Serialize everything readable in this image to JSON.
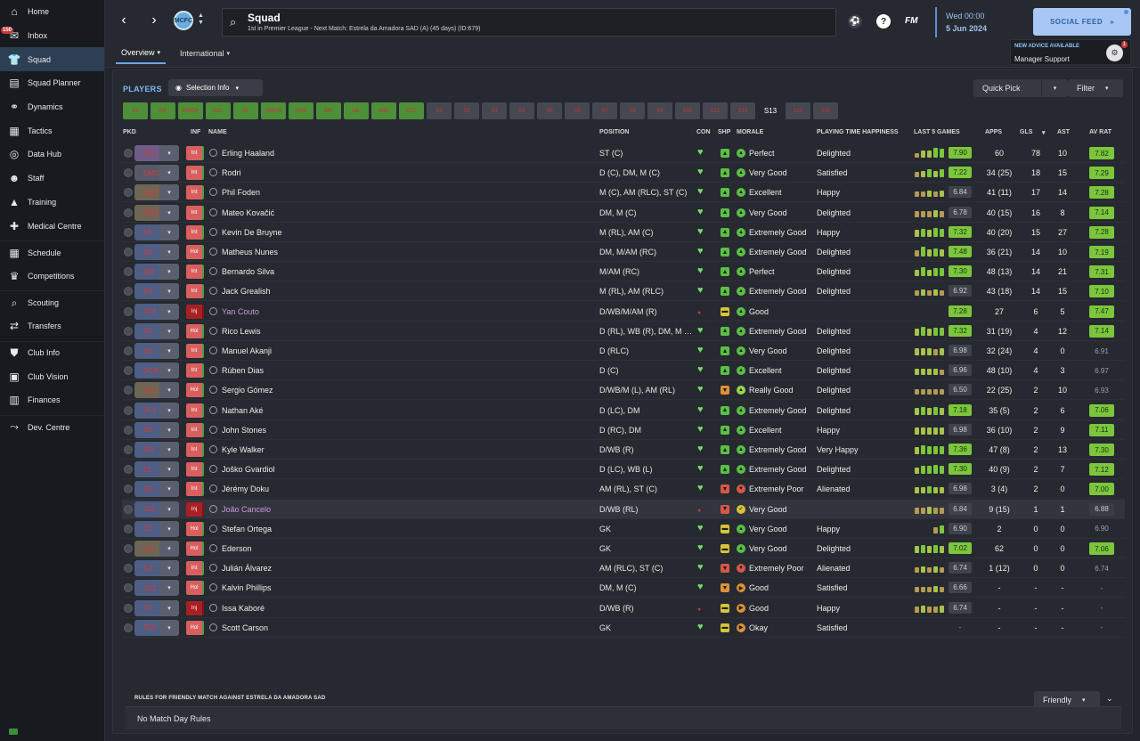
{
  "sidebar": {
    "items": [
      {
        "label": "Home",
        "icon": "home-icon",
        "glyph": "⌂"
      },
      {
        "label": "Inbox",
        "icon": "inbox-icon",
        "glyph": "✉",
        "badge": "150"
      },
      {
        "label": "Squad",
        "icon": "shirt-icon",
        "glyph": "👕",
        "active": true
      },
      {
        "label": "Squad Planner",
        "icon": "clipboard-icon",
        "glyph": "▤"
      },
      {
        "label": "Dynamics",
        "icon": "handshake-icon",
        "glyph": "⚭"
      },
      {
        "label": "Tactics",
        "icon": "tactics-board-icon",
        "glyph": "▦"
      },
      {
        "label": "Data Hub",
        "icon": "data-hub-icon",
        "glyph": "◎"
      },
      {
        "label": "Staff",
        "icon": "staff-icon",
        "glyph": "☻"
      },
      {
        "label": "Training",
        "icon": "training-cone-icon",
        "glyph": "▲"
      },
      {
        "label": "Medical Centre",
        "icon": "medical-kit-icon",
        "glyph": "✚"
      },
      {
        "label": "Schedule",
        "icon": "calendar-icon",
        "glyph": "▦",
        "gap": true
      },
      {
        "label": "Competitions",
        "icon": "trophy-icon",
        "glyph": "♛"
      },
      {
        "label": "Scouting",
        "icon": "magnifier-icon",
        "glyph": "⌕",
        "gap": true
      },
      {
        "label": "Transfers",
        "icon": "transfers-icon",
        "glyph": "⇄"
      },
      {
        "label": "Club Info",
        "icon": "shield-icon",
        "glyph": "⛊",
        "gap": true
      },
      {
        "label": "Club Vision",
        "icon": "briefcase-icon",
        "glyph": "▣"
      },
      {
        "label": "Finances",
        "icon": "finances-icon",
        "glyph": "▥"
      },
      {
        "label": "Dev. Centre",
        "icon": "dev-centre-icon",
        "glyph": "⤳",
        "gap": true
      }
    ]
  },
  "header": {
    "title": "Squad",
    "subtitle": "1st in Premier League - Next Match: Estrela da Amadora SAD (A) (45 days) (ID:679)",
    "fm": "FM",
    "date_day": "Wed 00:00",
    "date_full": "5 Jun 2024",
    "social_feed": "SOCIAL FEED",
    "advice_title": "NEW ADVICE AVAILABLE",
    "advice_sub": "Manager Support",
    "advice_badge": "1",
    "crest": "MCFC"
  },
  "tabs": {
    "overview": "Overview",
    "international": "International"
  },
  "toolbar": {
    "players": "PLAYERS",
    "selection_info": "Selection Info",
    "quick_pick": "Quick Pick",
    "filter": "Filter"
  },
  "chips": [
    {
      "label": "ST",
      "style": "g"
    },
    {
      "label": "GK",
      "style": "g"
    },
    {
      "label": "DMCR",
      "style": "g"
    },
    {
      "label": "DCL",
      "style": "g"
    },
    {
      "label": "DL",
      "style": "g"
    },
    {
      "label": "DMCR",
      "style": "g"
    },
    {
      "label": "AMC",
      "style": "g"
    },
    {
      "label": "MR",
      "style": "g"
    },
    {
      "label": "ML",
      "style": "g"
    },
    {
      "label": "AMC",
      "style": "g"
    },
    {
      "label": "STC",
      "style": "g"
    },
    {
      "label": "S1",
      "style": "d"
    },
    {
      "label": "S2",
      "style": "d"
    },
    {
      "label": "S3",
      "style": "d"
    },
    {
      "label": "S4",
      "style": "d"
    },
    {
      "label": "S5",
      "style": "d"
    },
    {
      "label": "S6",
      "style": "d"
    },
    {
      "label": "S7",
      "style": "d"
    },
    {
      "label": "S8",
      "style": "d"
    },
    {
      "label": "S9",
      "style": "d"
    },
    {
      "label": "S10",
      "style": "d"
    },
    {
      "label": "S11",
      "style": "d"
    },
    {
      "label": "S12",
      "style": "d"
    },
    {
      "label": "S13",
      "style": "b"
    },
    {
      "label": "S14",
      "style": "d"
    },
    {
      "label": "S15",
      "style": "d"
    }
  ],
  "columns": {
    "pkd": "PKD",
    "inf": "INF",
    "name": "NAME",
    "position": "POSITION",
    "con": "CON",
    "shp": "SHP",
    "morale": "MORALE",
    "pth": "PLAYING TIME HAPPINESS",
    "last5": "LAST 5 GAMES",
    "apps": "APPS",
    "gls": "GLS",
    "ast": "AST",
    "avrat": "AV RAT"
  },
  "players": [
    {
      "pkd": "STC",
      "tag": "p",
      "inf": "Int",
      "name": "Erling Haaland",
      "position": "ST (C)",
      "con": "g",
      "shp": "g",
      "mor": "g",
      "morale": "Perfect",
      "pth": "Delighted",
      "last5": [
        0.5,
        0.7,
        0.7,
        1,
        0.9
      ],
      "l5": "7.90",
      "l5c": "gr",
      "apps": "60",
      "gls": "78",
      "ast": "10",
      "avrat": "7.82",
      "avc": "gr"
    },
    {
      "pkd": "DMCL",
      "tag": "s",
      "inf": "Int",
      "name": "Rodri",
      "position": "D (C), DM, M (C)",
      "con": "g",
      "shp": "g",
      "mor": "g",
      "morale": "Very Good",
      "pth": "Satisfied",
      "last5": [
        0.6,
        0.7,
        0.8,
        0.7,
        0.8
      ],
      "l5": "7.22",
      "l5c": "gr",
      "apps": "34 (25)",
      "gls": "18",
      "ast": "15",
      "avrat": "7.29",
      "avc": "gr"
    },
    {
      "pkd": "AMC",
      "tag": "o",
      "inf": "Int",
      "name": "Phil Foden",
      "position": "M (C), AM (RLC), ST (C)",
      "con": "g",
      "shp": "g",
      "mor": "g",
      "morale": "Excellent",
      "pth": "Happy",
      "last5": [
        0.6,
        0.6,
        0.7,
        0.6,
        0.7
      ],
      "l5": "6.84",
      "l5c": "gy",
      "apps": "41 (11)",
      "gls": "17",
      "ast": "14",
      "avrat": "7.28",
      "avc": "gr"
    },
    {
      "pkd": "DMCR",
      "tag": "o",
      "inf": "Int",
      "name": "Mateo Kovačić",
      "position": "DM, M (C)",
      "con": "g",
      "shp": "g",
      "mor": "g",
      "morale": "Very Good",
      "pth": "Delighted",
      "last5": [
        0.6,
        0.6,
        0.6,
        0.7,
        0.6
      ],
      "l5": "6.78",
      "l5c": "gy",
      "apps": "40 (15)",
      "gls": "16",
      "ast": "8",
      "avrat": "7.14",
      "avc": "gr"
    },
    {
      "pkd": "ML",
      "tag": "",
      "inf": "Int",
      "name": "Kevin De Bruyne",
      "position": "M (RL), AM (C)",
      "con": "g",
      "shp": "g",
      "mor": "g",
      "morale": "Extremely Good",
      "pth": "Happy",
      "last5": [
        0.7,
        0.8,
        0.7,
        0.9,
        0.8
      ],
      "l5": "7.32",
      "l5c": "gr",
      "apps": "40 (20)",
      "gls": "15",
      "ast": "27",
      "avrat": "7.28",
      "avc": "gr"
    },
    {
      "pkd": "S6",
      "tag": "",
      "inf": "Hol",
      "name": "Matheus Nunes",
      "position": "DM, M/AM (RC)",
      "con": "g",
      "shp": "g",
      "mor": "g",
      "morale": "Extremely Good",
      "pth": "Delighted",
      "last5": [
        0.6,
        1,
        0.7,
        0.8,
        0.7
      ],
      "l5": "7.48",
      "l5c": "gr",
      "apps": "36 (21)",
      "gls": "14",
      "ast": "10",
      "avrat": "7.19",
      "avc": "gr"
    },
    {
      "pkd": "MR",
      "tag": "",
      "inf": "Int",
      "name": "Bernardo Silva",
      "position": "M/AM (RC)",
      "con": "g",
      "shp": "g",
      "mor": "g",
      "morale": "Perfect",
      "pth": "Delighted",
      "last5": [
        0.7,
        0.9,
        0.7,
        0.8,
        0.8
      ],
      "l5": "7.30",
      "l5c": "gr",
      "apps": "48 (13)",
      "gls": "14",
      "ast": "21",
      "avrat": "7.31",
      "avc": "gr"
    },
    {
      "pkd": "S3",
      "tag": "",
      "inf": "Int",
      "name": "Jack Grealish",
      "position": "M (RL), AM (RLC)",
      "con": "g",
      "shp": "g",
      "mor": "g",
      "morale": "Extremely Good",
      "pth": "Delighted",
      "last5": [
        0.6,
        0.7,
        0.6,
        0.7,
        0.6
      ],
      "l5": "6.92",
      "l5c": "gy",
      "apps": "43 (18)",
      "gls": "14",
      "ast": "15",
      "avrat": "7.10",
      "avc": "gr"
    },
    {
      "pkd": "S14",
      "tag": "",
      "inf": "Inj",
      "name": "Yan Couto",
      "position": "D/WB/M/AM (R)",
      "con": "r",
      "shp": "y",
      "mor": "g",
      "morale": "Good",
      "pth": "",
      "last5": [],
      "l5": "7.28",
      "l5c": "gr",
      "apps": "27",
      "gls": "6",
      "ast": "5",
      "avrat": "7.47",
      "avc": "gr"
    },
    {
      "pkd": "S2",
      "tag": "",
      "inf": "Hol",
      "name": "Rico Lewis",
      "position": "D (RL), WB (R), DM, M (C)",
      "con": "g",
      "shp": "g",
      "mor": "g",
      "morale": "Extremely Good",
      "pth": "Delighted",
      "last5": [
        0.7,
        0.9,
        0.7,
        0.8,
        0.8
      ],
      "l5": "7.32",
      "l5c": "gr",
      "apps": "31 (19)",
      "gls": "4",
      "ast": "12",
      "avrat": "7.14",
      "avc": "gr"
    },
    {
      "pkd": "S8",
      "tag": "",
      "inf": "Int",
      "name": "Manuel Akanji",
      "position": "D (RLC)",
      "con": "g",
      "shp": "g",
      "mor": "g",
      "morale": "Very Good",
      "pth": "Delighted",
      "last5": [
        0.7,
        0.7,
        0.7,
        0.6,
        0.7
      ],
      "l5": "6.98",
      "l5c": "gy",
      "apps": "32 (24)",
      "gls": "4",
      "ast": "0",
      "avrat": "6.91",
      "avc": "no"
    },
    {
      "pkd": "DCR",
      "tag": "",
      "inf": "Int",
      "name": "Rúben Dias",
      "position": "D (C)",
      "con": "g",
      "shp": "g",
      "mor": "g",
      "morale": "Excellent",
      "pth": "Delighted",
      "last5": [
        0.7,
        0.7,
        0.7,
        0.7,
        0.6
      ],
      "l5": "6.96",
      "l5c": "gy",
      "apps": "48 (10)",
      "gls": "4",
      "ast": "3",
      "avrat": "6.97",
      "avc": "no"
    },
    {
      "pkd": "S15",
      "tag": "o",
      "inf": "Hol",
      "name": "Sergio Gómez",
      "position": "D/WB/M (L), AM (RL)",
      "con": "g",
      "shp": "o",
      "mor": "g2",
      "morale": "Really Good",
      "pth": "Delighted",
      "last5": [
        0.6,
        0.6,
        0.6,
        0.6,
        0.6
      ],
      "l5": "6.50",
      "l5c": "gy",
      "apps": "22 (25)",
      "gls": "2",
      "ast": "10",
      "avrat": "6.93",
      "avc": "no"
    },
    {
      "pkd": "DCL",
      "tag": "",
      "inf": "Int",
      "name": "Nathan Aké",
      "position": "D (LC), DM",
      "con": "g",
      "shp": "g",
      "mor": "g",
      "morale": "Extremely Good",
      "pth": "Delighted",
      "last5": [
        0.7,
        0.8,
        0.7,
        0.8,
        0.7
      ],
      "l5": "7.18",
      "l5c": "gr",
      "apps": "35 (5)",
      "gls": "2",
      "ast": "6",
      "avrat": "7.06",
      "avc": "gr"
    },
    {
      "pkd": "S5",
      "tag": "",
      "inf": "Int",
      "name": "John Stones",
      "position": "D (RC), DM",
      "con": "g",
      "shp": "g",
      "mor": "g",
      "morale": "Excellent",
      "pth": "Happy",
      "last5": [
        0.7,
        0.7,
        0.7,
        0.7,
        0.7
      ],
      "l5": "6.98",
      "l5c": "gy",
      "apps": "36 (10)",
      "gls": "2",
      "ast": "9",
      "avrat": "7.11",
      "avc": "gr"
    },
    {
      "pkd": "DR",
      "tag": "",
      "inf": "Int",
      "name": "Kyle Walker",
      "position": "D/WB (R)",
      "con": "g",
      "shp": "g",
      "mor": "g",
      "morale": "Extremely Good",
      "pth": "Very Happy",
      "last5": [
        0.7,
        0.9,
        0.8,
        0.8,
        0.8
      ],
      "l5": "7.36",
      "l5c": "gr",
      "apps": "47 (8)",
      "gls": "2",
      "ast": "13",
      "avrat": "7.30",
      "avc": "gr"
    },
    {
      "pkd": "DL",
      "tag": "",
      "inf": "Int",
      "name": "Joško Gvardiol",
      "position": "D (LC), WB (L)",
      "con": "g",
      "shp": "g",
      "mor": "g",
      "morale": "Extremely Good",
      "pth": "Delighted",
      "last5": [
        0.7,
        0.8,
        0.8,
        0.9,
        0.8
      ],
      "l5": "7.30",
      "l5c": "gr",
      "apps": "40 (9)",
      "gls": "2",
      "ast": "7",
      "avrat": "7.12",
      "avc": "gr"
    },
    {
      "pkd": "S9",
      "tag": "",
      "inf": "Int",
      "name": "Jérémy Doku",
      "position": "AM (RL), ST (C)",
      "con": "g",
      "shp": "r",
      "mor": "r",
      "morale": "Extremely Poor",
      "pth": "Alienated",
      "last5": [
        0.7,
        0.7,
        0.8,
        0.7,
        0.7
      ],
      "l5": "6.98",
      "l5c": "gy",
      "apps": "3 (4)",
      "gls": "2",
      "ast": "0",
      "avrat": "7.00",
      "avc": "gr"
    },
    {
      "pkd": "S11",
      "tag": "",
      "inf": "Inj",
      "name": "João Cancelo",
      "position": "D/WB (RL)",
      "con": "r",
      "shp": "r",
      "mor": "y",
      "morale": "Very Good",
      "pth": "",
      "last5": [
        0.6,
        0.6,
        0.7,
        0.6,
        0.6
      ],
      "l5": "6.84",
      "l5c": "gy",
      "apps": "9 (15)",
      "gls": "1",
      "ast": "1",
      "avrat": "6.88",
      "avc": "gy",
      "hl": true
    },
    {
      "pkd": "S1",
      "tag": "",
      "inf": "Hol",
      "name": "Stefan Ortega",
      "position": "GK",
      "con": "g",
      "shp": "y",
      "mor": "g",
      "morale": "Very Good",
      "pth": "Happy",
      "last5": [
        0,
        0,
        0,
        0.6,
        0.8
      ],
      "l5": "6.90",
      "l5c": "gy",
      "apps": "2",
      "gls": "0",
      "ast": "0",
      "avrat": "6.90",
      "avc": "no"
    },
    {
      "pkd": "GK",
      "tag": "o",
      "inf": "Hol",
      "name": "Ederson",
      "position": "GK",
      "con": "g",
      "shp": "y",
      "mor": "g",
      "morale": "Very Good",
      "pth": "Delighted",
      "last5": [
        0.7,
        0.8,
        0.7,
        0.8,
        0.7
      ],
      "l5": "7.02",
      "l5c": "gr",
      "apps": "62",
      "gls": "0",
      "ast": "0",
      "avrat": "7.06",
      "avc": "gr"
    },
    {
      "pkd": "S4",
      "tag": "",
      "inf": "Int",
      "name": "Julián Álvarez",
      "position": "AM (RLC), ST (C)",
      "con": "g",
      "shp": "r",
      "mor": "r",
      "morale": "Extremely Poor",
      "pth": "Alienated",
      "last5": [
        0.6,
        0.7,
        0.6,
        0.7,
        0.6
      ],
      "l5": "6.74",
      "l5c": "gy",
      "apps": "1 (12)",
      "gls": "0",
      "ast": "0",
      "avrat": "6.74",
      "avc": "no"
    },
    {
      "pkd": "S12",
      "tag": "",
      "inf": "Hol",
      "name": "Kalvin Phillips",
      "position": "DM, M (C)",
      "con": "g",
      "shp": "o",
      "mor": "o",
      "morale": "Good",
      "pth": "Satisfied",
      "last5": [
        0.6,
        0.6,
        0.6,
        0.7,
        0.6
      ],
      "l5": "6.66",
      "l5c": "gy",
      "apps": "-",
      "gls": "-",
      "ast": "-",
      "avrat": "-",
      "avc": "no"
    },
    {
      "pkd": "S7",
      "tag": "",
      "inf": "Inj",
      "name": "Issa Kaboré",
      "position": "D/WB (R)",
      "con": "r",
      "shp": "y",
      "mor": "o",
      "morale": "Good",
      "pth": "Happy",
      "last5": [
        0.6,
        0.7,
        0.6,
        0.6,
        0.7
      ],
      "l5": "6.74",
      "l5c": "gy",
      "apps": "-",
      "gls": "-",
      "ast": "-",
      "avrat": "-",
      "avc": "no"
    },
    {
      "pkd": "S10",
      "tag": "",
      "inf": "Hol",
      "name": "Scott Carson",
      "position": "GK",
      "con": "g",
      "shp": "y",
      "mor": "o",
      "morale": "Okay",
      "pth": "Satisfied",
      "last5": [],
      "l5": "-",
      "l5c": "no",
      "apps": "-",
      "gls": "-",
      "ast": "-",
      "avrat": "-",
      "avc": "no"
    }
  ],
  "rules": {
    "title": "RULES FOR FRIENDLY MATCH AGAINST ESTRELA DA AMADORA SAD",
    "text": "No Match Day Rules",
    "friendly": "Friendly"
  }
}
